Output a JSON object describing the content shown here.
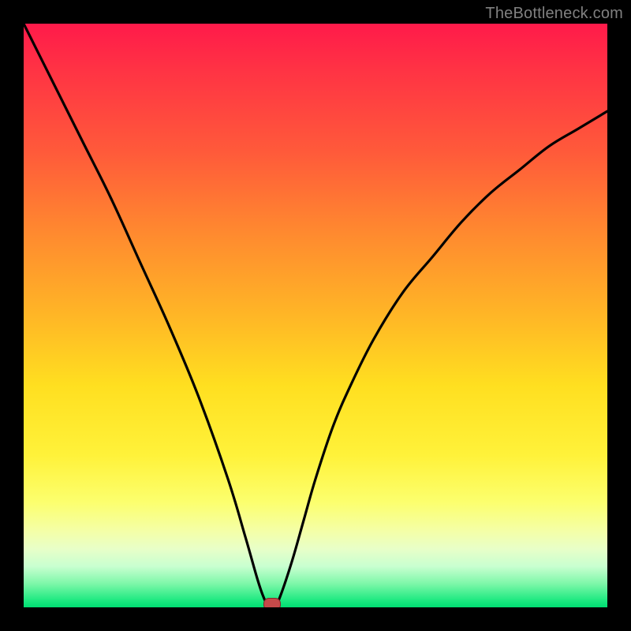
{
  "watermark": "TheBottleneck.com",
  "chart_data": {
    "type": "line",
    "title": "",
    "xlabel": "",
    "ylabel": "",
    "xlim": [
      0,
      100
    ],
    "ylim": [
      0,
      100
    ],
    "series": [
      {
        "name": "bottleneck-curve",
        "x": [
          0,
          5,
          10,
          15,
          20,
          25,
          30,
          35,
          38,
          40,
          41,
          42,
          43,
          44,
          46,
          48,
          50,
          53,
          56,
          60,
          65,
          70,
          75,
          80,
          85,
          90,
          95,
          100
        ],
        "values": [
          100,
          90,
          80,
          70,
          59,
          48,
          36,
          22,
          12,
          5,
          2,
          0,
          0,
          2,
          8,
          15,
          22,
          31,
          38,
          46,
          54,
          60,
          66,
          71,
          75,
          79,
          82,
          85
        ]
      }
    ],
    "dip": {
      "x": 42.5,
      "y": 0
    },
    "gradient_stops": [
      {
        "pos": 0,
        "color": "#ff1a4a"
      },
      {
        "pos": 50,
        "color": "#ffd820"
      },
      {
        "pos": 88,
        "color": "#f8ffb0"
      },
      {
        "pos": 100,
        "color": "#00de72"
      }
    ]
  }
}
